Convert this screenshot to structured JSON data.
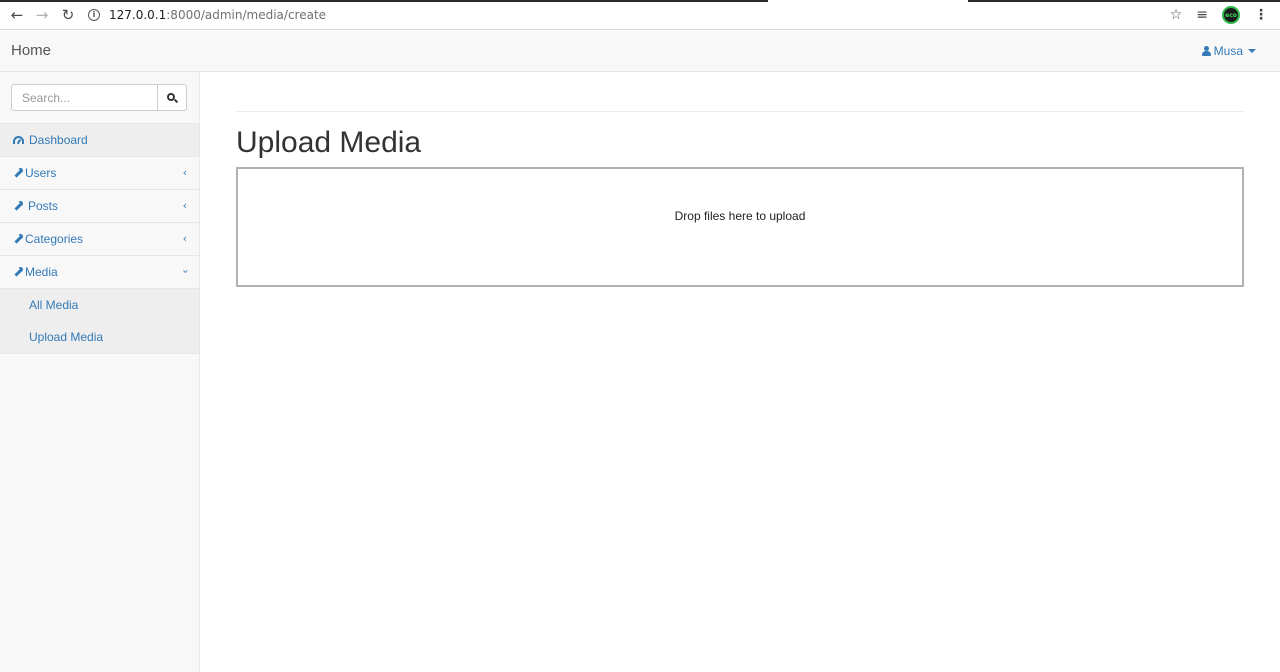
{
  "browser": {
    "url_host": "127.0.0.1",
    "url_path": ":8000/admin/media/create",
    "eco_label": "eco"
  },
  "navbar": {
    "brand": "Home",
    "user_name": "Musa"
  },
  "sidebar": {
    "search_placeholder": "Search...",
    "items": [
      {
        "label": "Dashboard",
        "icon": "dashboard-icon"
      },
      {
        "label": "Users",
        "icon": "wrench-icon"
      },
      {
        "label": "Posts",
        "icon": "wrench-icon"
      },
      {
        "label": "Categories",
        "icon": "wrench-icon"
      },
      {
        "label": "Media",
        "icon": "wrench-icon"
      }
    ],
    "media_sub_items": [
      {
        "label": "All Media"
      },
      {
        "label": "Upload Media"
      }
    ]
  },
  "main": {
    "title": "Upload Media",
    "dropzone_message": "Drop files here to upload"
  },
  "colors": {
    "link": "#337ab7",
    "navbar_bg": "#f8f8f8",
    "active_bg": "#eeeeee"
  }
}
